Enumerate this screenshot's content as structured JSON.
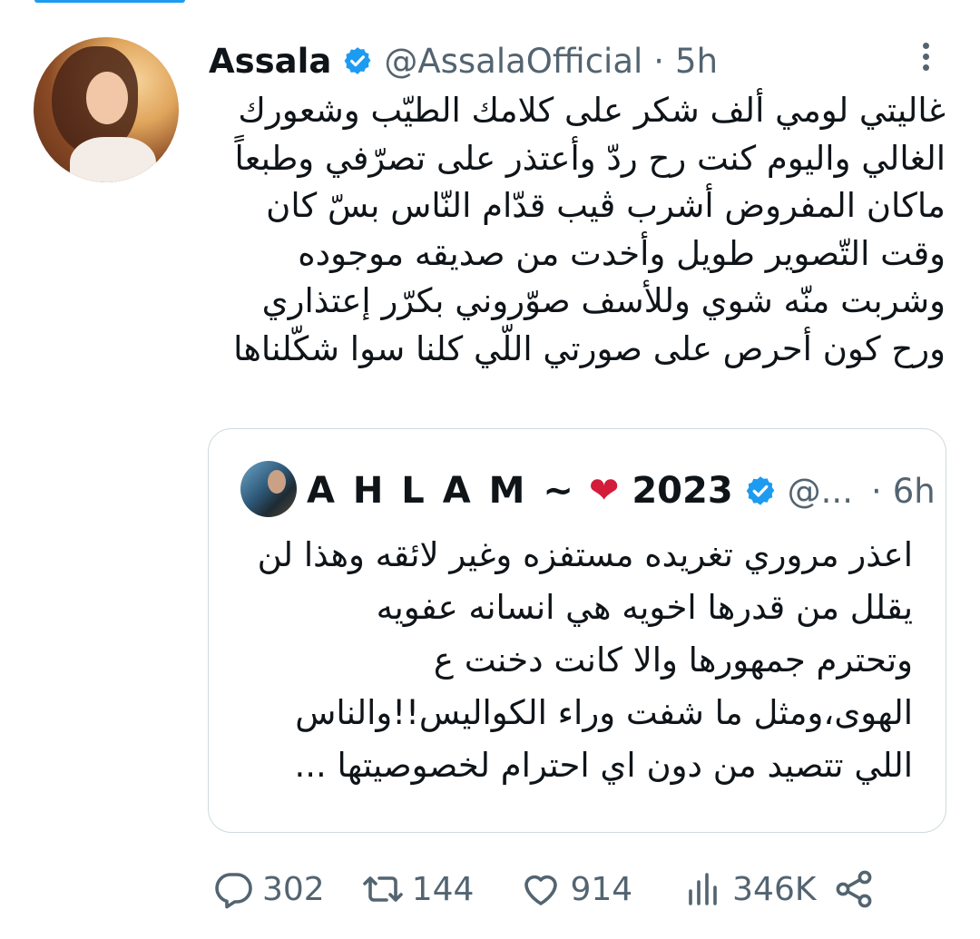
{
  "author": {
    "name": "Assala",
    "handle": "@AssalaOfficial",
    "separator": "·",
    "time": "5h"
  },
  "tweet": {
    "lines": [
      "غاليتي لومي ألف شكر على كلامك الطيّب وشعورك",
      "الغالي واليوم كنت رح ردّ وأعتذر على تصرّفي وطبعاً",
      "ماكان المفروض أشرب ڤيب قدّام النّاس بسّ كان",
      "وقت التّصوير طويل وأخدت من صديقه موجوده",
      "وشربت منّه شوي وللأسف صوّروني بكرّر إعتذاري",
      "ورح كون أحرص على صورتي اللّي كلنا سوا شكّلناها"
    ]
  },
  "quoted": {
    "name": "A H L A M ~",
    "heart": "❤",
    "year": "2023",
    "handle": "@...",
    "separator": "·",
    "time": "6h",
    "lines": [
      "اعذر مروري تغريده مستفزه وغير لائقه وهذا لن",
      "يقلل من قدرها اخويه هي انسانه عفويه",
      "وتحترم جمهورها والا كانت دخنت ع",
      "الهوى،ومثل ما شفت وراء الكواليس!!والناس",
      "اللي تتصيد من دون اي احترام لخصوصيتها ..."
    ]
  },
  "actions": {
    "replies": "302",
    "retweets": "144",
    "likes": "914",
    "views": "346K"
  },
  "icons": {
    "verified": "verified-badge-icon",
    "more": "more-vertical-icon",
    "reply": "reply-icon",
    "retweet": "retweet-icon",
    "like": "heart-icon",
    "views": "views-icon",
    "share": "share-icon"
  },
  "colors": {
    "accent": "#1d9bf0",
    "text": "#0f1419",
    "secondary": "#536471",
    "border": "#cfd9de",
    "heart": "#d31b3a"
  }
}
